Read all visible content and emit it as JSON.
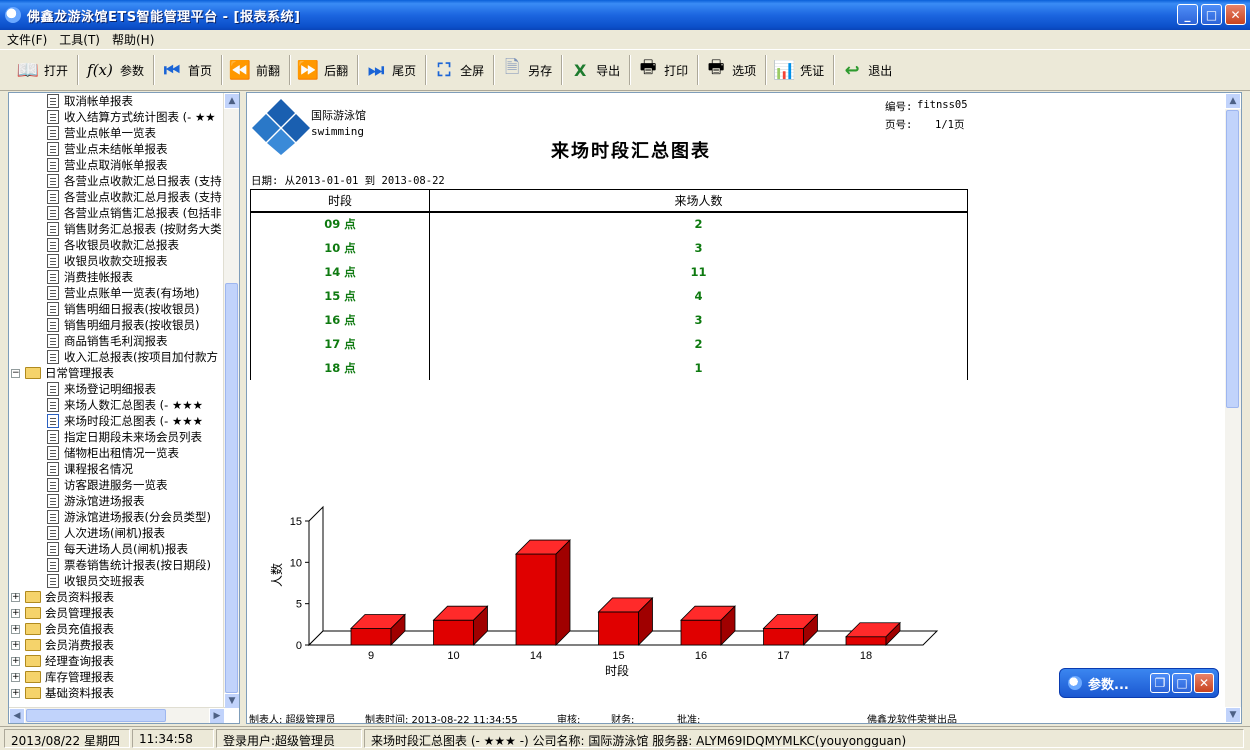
{
  "window": {
    "title": "佛鑫龙游泳馆ETS智能管理平台 - [报表系统]"
  },
  "menu": [
    {
      "label": "文件(F)"
    },
    {
      "label": "工具(T)"
    },
    {
      "label": "帮助(H)"
    }
  ],
  "toolbar": {
    "open": "打开",
    "params": "参数",
    "first": "首页",
    "prev": "前翻",
    "next": "后翻",
    "last": "尾页",
    "fullscreen": "全屏",
    "saveas": "另存",
    "export": "导出",
    "print": "打印",
    "options": "选项",
    "voucher": "凭证",
    "exit": "退出"
  },
  "tree": {
    "items": [
      {
        "label": "取消帐单报表",
        "kind": "doc",
        "level": 2
      },
      {
        "label": "收入结算方式统计图表 (- ★★",
        "kind": "doc",
        "level": 2
      },
      {
        "label": "营业点帐单一览表",
        "kind": "doc",
        "level": 2
      },
      {
        "label": "营业点未结帐单报表",
        "kind": "doc",
        "level": 2
      },
      {
        "label": "营业点取消帐单报表",
        "kind": "doc",
        "level": 2
      },
      {
        "label": "各营业点收款汇总日报表 (支持",
        "kind": "doc",
        "level": 2
      },
      {
        "label": "各营业点收款汇总月报表 (支持",
        "kind": "doc",
        "level": 2
      },
      {
        "label": "各营业点销售汇总报表 (包括非",
        "kind": "doc",
        "level": 2
      },
      {
        "label": "销售财务汇总报表 (按财务大类",
        "kind": "doc",
        "level": 2
      },
      {
        "label": "各收银员收款汇总报表",
        "kind": "doc",
        "level": 2
      },
      {
        "label": "收银员收款交班报表",
        "kind": "doc",
        "level": 2
      },
      {
        "label": "消费挂帐报表",
        "kind": "doc",
        "level": 2
      },
      {
        "label": "营业点账单一览表(有场地)",
        "kind": "doc",
        "level": 2
      },
      {
        "label": "销售明细日报表(按收银员)",
        "kind": "doc",
        "level": 2
      },
      {
        "label": "销售明细月报表(按收银员)",
        "kind": "doc",
        "level": 2
      },
      {
        "label": "商品销售毛利润报表",
        "kind": "doc",
        "level": 2
      },
      {
        "label": "收入汇总报表(按项目加付款方",
        "kind": "doc",
        "level": 2
      },
      {
        "label": "日常管理报表",
        "kind": "folder-open",
        "level": 1
      },
      {
        "label": "来场登记明细报表",
        "kind": "doc",
        "level": 2
      },
      {
        "label": "来场人数汇总图表 (- ★★★",
        "kind": "doc",
        "level": 2
      },
      {
        "label": "来场时段汇总图表 (- ★★★",
        "kind": "doc-selected",
        "level": 2
      },
      {
        "label": "指定日期段未来场会员列表",
        "kind": "doc",
        "level": 2
      },
      {
        "label": "储物柜出租情况一览表",
        "kind": "doc",
        "level": 2
      },
      {
        "label": "课程报名情况",
        "kind": "doc",
        "level": 2
      },
      {
        "label": "访客跟进服务一览表",
        "kind": "doc",
        "level": 2
      },
      {
        "label": "游泳馆进场报表",
        "kind": "doc",
        "level": 2
      },
      {
        "label": "游泳馆进场报表(分会员类型)",
        "kind": "doc",
        "level": 2
      },
      {
        "label": "人次进场(闸机)报表",
        "kind": "doc",
        "level": 2
      },
      {
        "label": "每天进场人员(闸机)报表",
        "kind": "doc",
        "level": 2
      },
      {
        "label": "票卷销售统计报表(按日期段)",
        "kind": "doc",
        "level": 2
      },
      {
        "label": "收银员交班报表",
        "kind": "doc",
        "level": 2
      },
      {
        "label": "会员资料报表",
        "kind": "folder",
        "level": 1
      },
      {
        "label": "会员管理报表",
        "kind": "folder",
        "level": 1
      },
      {
        "label": "会员充值报表",
        "kind": "folder",
        "level": 1
      },
      {
        "label": "会员消费报表",
        "kind": "folder",
        "level": 1
      },
      {
        "label": "经理查询报表",
        "kind": "folder",
        "level": 1
      },
      {
        "label": "库存管理报表",
        "kind": "folder",
        "level": 1
      },
      {
        "label": "基础资料报表",
        "kind": "folder",
        "level": 1
      }
    ]
  },
  "report": {
    "logo_name": "国际游泳馆",
    "logo_sub": "swimming",
    "code_label": "编号:",
    "code_value": "fitnss05",
    "page_label": "页号:",
    "page_value": "1/1页",
    "title": "来场时段汇总图表",
    "date_range": "日期: 从2013-01-01 到 2013-08-22",
    "table": {
      "headers": [
        "时段",
        "来场人数"
      ],
      "rows": [
        {
          "period": "09 点",
          "count": "2"
        },
        {
          "period": "10 点",
          "count": "3"
        },
        {
          "period": "14 点",
          "count": "11"
        },
        {
          "period": "15 点",
          "count": "4"
        },
        {
          "period": "16 点",
          "count": "3"
        },
        {
          "period": "17 点",
          "count": "2"
        },
        {
          "period": "18 点",
          "count": "1"
        }
      ]
    },
    "footer": {
      "maker": "制表人: 超级管理员",
      "time": "制表时间: 2013-08-22 11:34:55",
      "audit": "审核:",
      "finance": "财务:",
      "approve": "批准:",
      "vendor": "佛鑫龙软件荣誉出品"
    }
  },
  "chart_data": {
    "type": "bar",
    "categories": [
      "9",
      "10",
      "14",
      "15",
      "16",
      "17",
      "18"
    ],
    "values": [
      2,
      3,
      11,
      4,
      3,
      2,
      1
    ],
    "xlabel": "时段",
    "ylabel": "人数",
    "ylim": [
      0,
      15
    ],
    "yticks": [
      0,
      5,
      10,
      15
    ],
    "bar_color": "#e00000",
    "grid": false,
    "style": "3d"
  },
  "param_window": {
    "title": "参数..."
  },
  "status": {
    "date": "2013/08/22 星期四",
    "time": "11:34:58",
    "user": "登录用户:超级管理员",
    "info": "来场时段汇总图表 (- ★★★ -) 公司名称: 国际游泳馆 服务器: ALYM69IDQMYMLKC(youyongguan)"
  }
}
